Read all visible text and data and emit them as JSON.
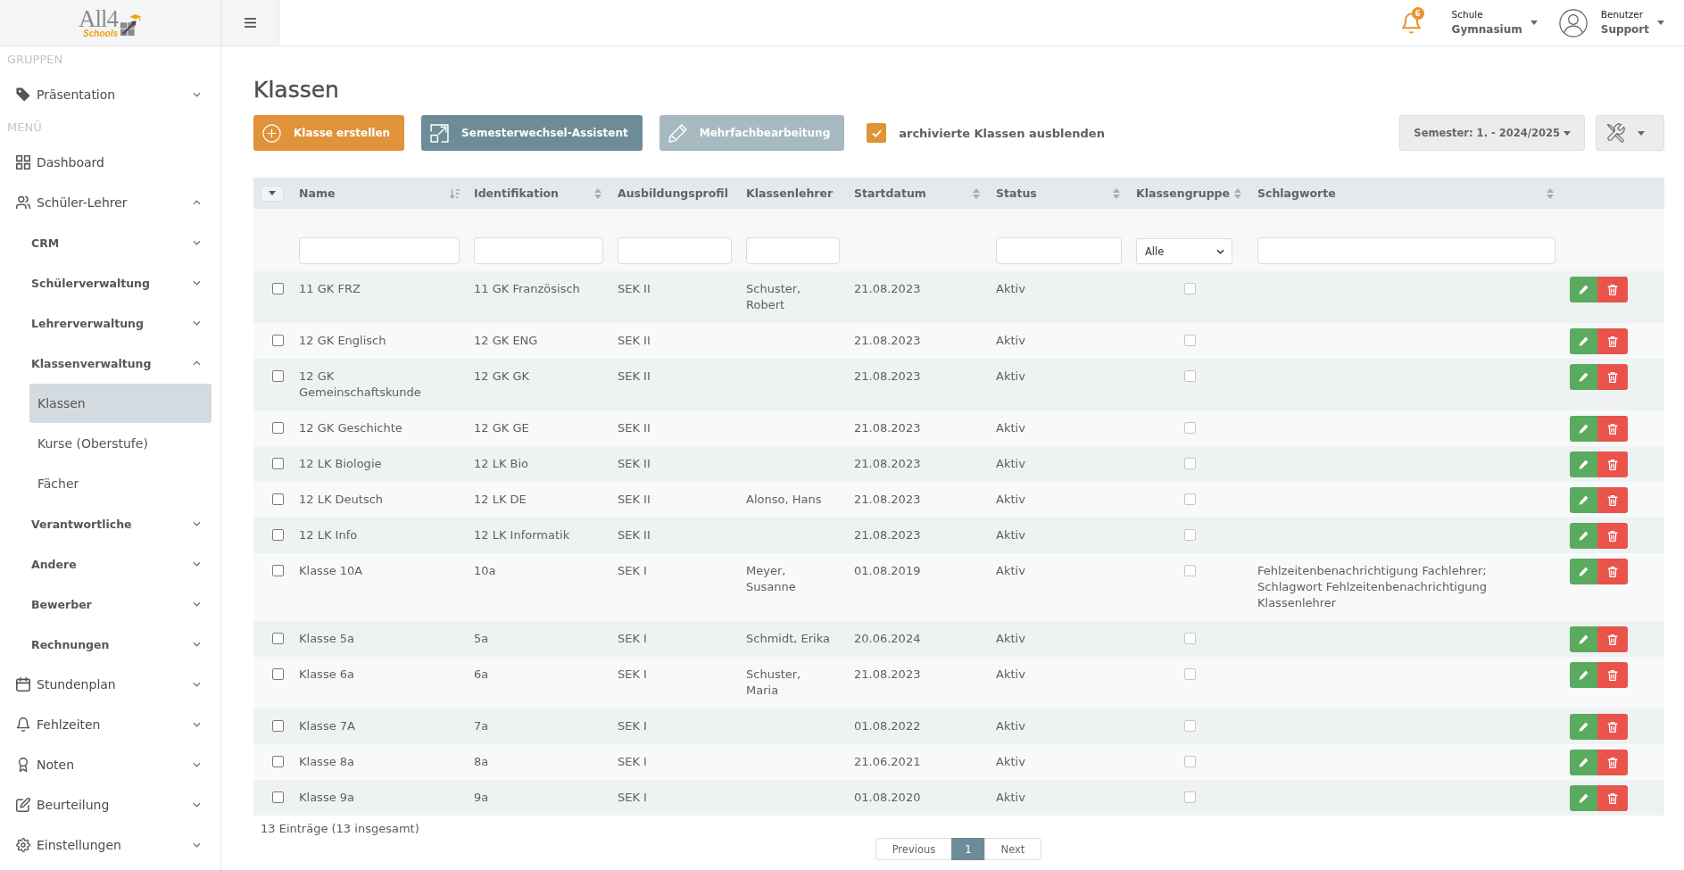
{
  "header": {
    "logo": {
      "title": "All4",
      "subtitle": "Schools"
    },
    "notifications": {
      "count": "6"
    },
    "school": {
      "label": "Schule",
      "value": "Gymnasium"
    },
    "user": {
      "label": "Benutzer",
      "value": "Support"
    }
  },
  "sidebar": {
    "sections": [
      {
        "label": "GRUPPEN",
        "items": [
          {
            "label": "Präsentation",
            "selected": false,
            "expanded": false
          }
        ]
      },
      {
        "label": "MENÜ",
        "items": [
          {
            "label": "Dashboard",
            "selected": false
          },
          {
            "label": "Schüler-Lehrer",
            "selected": false,
            "expanded": true,
            "children": [
              {
                "label": "CRM",
                "selected": false,
                "expanded": false
              },
              {
                "label": "Schülerverwaltung",
                "selected": false,
                "expanded": false
              },
              {
                "label": "Lehrerverwaltung",
                "selected": false,
                "expanded": false
              },
              {
                "label": "Klassenverwaltung",
                "selected": false,
                "expanded": true,
                "children": [
                  {
                    "label": "Klassen",
                    "selected": true
                  },
                  {
                    "label": "Kurse (Oberstufe)",
                    "selected": false
                  },
                  {
                    "label": "Fächer",
                    "selected": false
                  }
                ]
              },
              {
                "label": "Verantwortliche",
                "selected": false,
                "expanded": false
              },
              {
                "label": "Andere",
                "selected": false,
                "expanded": false
              },
              {
                "label": "Bewerber",
                "selected": false,
                "expanded": false
              },
              {
                "label": "Rechnungen",
                "selected": false,
                "expanded": false
              }
            ]
          },
          {
            "label": "Stundenplan",
            "selected": false,
            "expanded": false
          },
          {
            "label": "Fehlzeiten",
            "selected": false,
            "expanded": false
          },
          {
            "label": "Noten",
            "selected": false,
            "expanded": false
          },
          {
            "label": "Beurteilung",
            "selected": false,
            "expanded": false
          },
          {
            "label": "Einstellungen",
            "selected": false,
            "expanded": false
          }
        ]
      }
    ]
  },
  "page": {
    "title": "Klassen"
  },
  "toolbar": {
    "buttons": [
      {
        "kind": "create",
        "label": "Klasse erstellen",
        "disabled": false
      },
      {
        "kind": "wizard",
        "label": "Semesterwechsel-Assistent",
        "disabled": false
      },
      {
        "kind": "bulk-edit",
        "label": "Mehrfachbearbeitung",
        "disabled": true
      }
    ],
    "archive_filter": {
      "label": "archivierte Klassen ausblenden",
      "checked": true
    },
    "semester": {
      "label": "Semester: 1. - 2024/2025"
    }
  },
  "table": {
    "columns": [
      {
        "label": "Name",
        "sorted": true,
        "filter": {
          "kind": "input"
        }
      },
      {
        "label": "Identifikation",
        "sortable": true,
        "filter": {
          "kind": "input"
        }
      },
      {
        "label": "Ausbildungsprofil",
        "filter": {
          "kind": "input"
        }
      },
      {
        "label": "Klassenlehrer",
        "filter": {
          "kind": "input"
        }
      },
      {
        "label": "Startdatum",
        "sortable": true
      },
      {
        "label": "Status",
        "sortable": true,
        "filter": {
          "kind": "input"
        }
      },
      {
        "label": "Klassengruppe",
        "sortable": true,
        "filter": {
          "kind": "select",
          "value": "Alle"
        }
      },
      {
        "label": "Schlagworte",
        "sortable": true,
        "filter": {
          "kind": "input"
        }
      }
    ],
    "rows": [
      {
        "checked": false,
        "name": "11 GK FRZ",
        "identifikation": "11 GK Französisch",
        "ausbildungsprofil": "SEK II",
        "klassenlehrer": "Schuster, Robert",
        "startdatum": "21.08.2023",
        "status": "Aktiv",
        "klassengruppe": false
      },
      {
        "checked": false,
        "name": "12 GK Englisch",
        "identifikation": "12 GK ENG",
        "ausbildungsprofil": "SEK II",
        "startdatum": "21.08.2023",
        "status": "Aktiv",
        "klassengruppe": false
      },
      {
        "checked": false,
        "name": "12 GK Gemeinschaftskunde",
        "identifikation": "12 GK GK",
        "ausbildungsprofil": "SEK II",
        "startdatum": "21.08.2023",
        "status": "Aktiv",
        "klassengruppe": false
      },
      {
        "checked": false,
        "name": "12 GK Geschichte",
        "identifikation": "12 GK GE",
        "ausbildungsprofil": "SEK II",
        "startdatum": "21.08.2023",
        "status": "Aktiv",
        "klassengruppe": false
      },
      {
        "checked": false,
        "name": "12 LK Biologie",
        "identifikation": "12 LK Bio",
        "ausbildungsprofil": "SEK II",
        "startdatum": "21.08.2023",
        "status": "Aktiv",
        "klassengruppe": false
      },
      {
        "checked": false,
        "name": "12 LK Deutsch",
        "identifikation": "12 LK DE",
        "ausbildungsprofil": "SEK II",
        "klassenlehrer": "Alonso, Hans",
        "startdatum": "21.08.2023",
        "status": "Aktiv",
        "klassengruppe": false
      },
      {
        "checked": false,
        "name": "12 LK Info",
        "identifikation": "12 LK Informatik",
        "ausbildungsprofil": "SEK II",
        "startdatum": "21.08.2023",
        "status": "Aktiv",
        "klassengruppe": false
      },
      {
        "checked": false,
        "name": "Klasse 10A",
        "identifikation": "10a",
        "ausbildungsprofil": "SEK I",
        "klassenlehrer": "Meyer, Susanne",
        "startdatum": "01.08.2019",
        "status": "Aktiv",
        "klassengruppe": false,
        "schlagworte": "Fehlzeitenbenachrichtigung Fachlehrer; Schlagwort Fehlzeitenbenachrichtigung Klassenlehrer"
      },
      {
        "checked": false,
        "name": "Klasse 5a",
        "identifikation": "5a",
        "ausbildungsprofil": "SEK I",
        "klassenlehrer": "Schmidt, Erika",
        "startdatum": "20.06.2024",
        "status": "Aktiv",
        "klassengruppe": false
      },
      {
        "checked": false,
        "name": "Klasse 6a",
        "identifikation": "6a",
        "ausbildungsprofil": "SEK I",
        "klassenlehrer": "Schuster, Maria",
        "startdatum": "21.08.2023",
        "status": "Aktiv",
        "klassengruppe": false
      },
      {
        "checked": false,
        "name": "Klasse 7A",
        "identifikation": "7a",
        "ausbildungsprofil": "SEK I",
        "startdatum": "01.08.2022",
        "status": "Aktiv",
        "klassengruppe": false
      },
      {
        "checked": false,
        "name": "Klasse 8a",
        "identifikation": "8a",
        "ausbildungsprofil": "SEK I",
        "startdatum": "21.06.2021",
        "status": "Aktiv",
        "klassengruppe": false
      },
      {
        "checked": false,
        "name": "Klasse 9a",
        "identifikation": "9a",
        "ausbildungsprofil": "SEK I",
        "startdatum": "01.08.2020",
        "status": "Aktiv",
        "klassengruppe": false
      }
    ]
  },
  "footer": {
    "summary": "13 Einträge (13 insgesamt)",
    "pagination": [
      {
        "label": "Previous",
        "selected": false
      },
      {
        "label": "1",
        "selected": true
      },
      {
        "label": "Next",
        "selected": false
      }
    ]
  }
}
